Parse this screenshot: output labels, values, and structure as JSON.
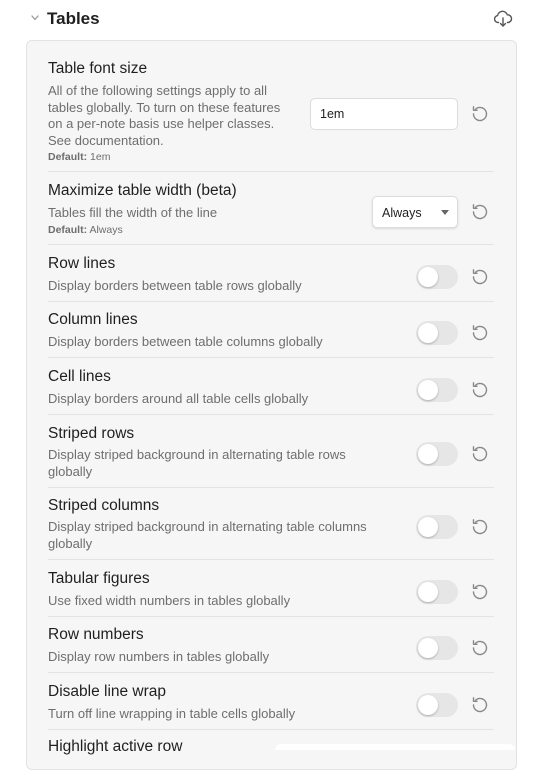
{
  "section": {
    "title": "Tables",
    "collapse_icon": "chevron-down-icon",
    "action_icon": "cloud-download-icon"
  },
  "settings": [
    {
      "key": "font_size",
      "title": "Table font size",
      "description": "All of the following settings apply to all tables globally. To turn on these features on a per-note basis use helper classes. See documentation.",
      "default_label": "Default:",
      "default_value": "1em",
      "control": "text",
      "value": "1em"
    },
    {
      "key": "max_width",
      "title": "Maximize table width (beta)",
      "description": "Tables fill the width of the line",
      "default_label": "Default:",
      "default_value": "Always",
      "control": "select",
      "value": "Always"
    },
    {
      "key": "row_lines",
      "title": "Row lines",
      "description": "Display borders between table rows globally",
      "control": "toggle",
      "enabled": false
    },
    {
      "key": "column_lines",
      "title": "Column lines",
      "description": "Display borders between table columns globally",
      "control": "toggle",
      "enabled": false
    },
    {
      "key": "cell_lines",
      "title": "Cell lines",
      "description": "Display borders around all table cells globally",
      "control": "toggle",
      "enabled": false
    },
    {
      "key": "striped_rows",
      "title": "Striped rows",
      "description": "Display striped background in alternating table rows globally",
      "control": "toggle",
      "enabled": false
    },
    {
      "key": "striped_columns",
      "title": "Striped columns",
      "description": "Display striped background in alternating table columns globally",
      "control": "toggle",
      "enabled": false
    },
    {
      "key": "tabular_figures",
      "title": "Tabular figures",
      "description": "Use fixed width numbers in tables globally",
      "control": "toggle",
      "enabled": false
    },
    {
      "key": "row_numbers",
      "title": "Row numbers",
      "description": "Display row numbers in tables globally",
      "control": "toggle",
      "enabled": false
    },
    {
      "key": "disable_wrap",
      "title": "Disable line wrap",
      "description": "Turn off line wrapping in table cells globally",
      "control": "toggle",
      "enabled": false
    },
    {
      "key": "highlight_row",
      "title": "Highlight active row",
      "control": "toggle",
      "enabled": false
    }
  ],
  "icons": {
    "reset": "reset-icon",
    "toggle_track_off": "#e6e6e6"
  },
  "colors": {
    "panel_bg": "#f6f6f6",
    "divider": "#e3e3e3",
    "muted_text": "#6e6e6e"
  }
}
